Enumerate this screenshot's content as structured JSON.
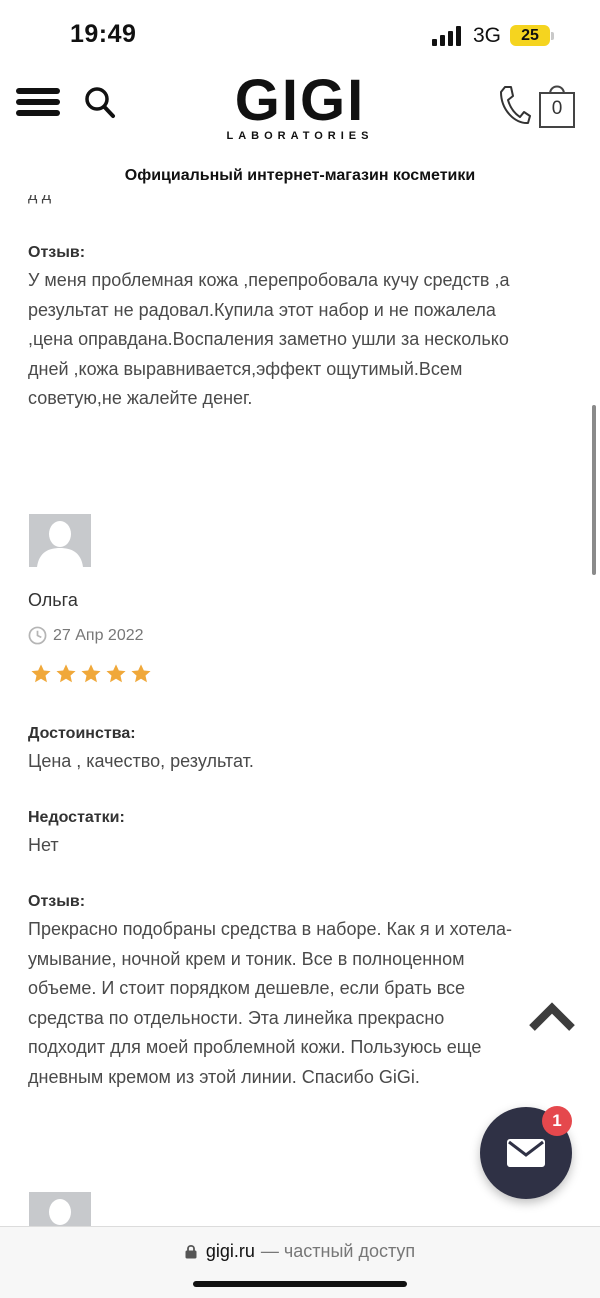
{
  "status_bar": {
    "time": "19:49",
    "network": "3G",
    "battery": "25"
  },
  "header": {
    "logo_main": "GIGI",
    "logo_sub": "LABORATORIES",
    "cart_count": "0",
    "tagline": "Официальный интернет-магазин косметики"
  },
  "review_prev": {
    "label": "Отзыв:",
    "text": "У меня проблемная кожа ,перепробовала кучу средств ,а\nрезультат не радовал.Купила этот набор и не пожалела\n,цена оправдана.Воспаления заметно ушли за несколько\nдней ,кожа выравнивается,эффект ощутимый.Всем\nсоветую,не жалейте денег."
  },
  "review": {
    "author": "Ольга",
    "date": "27 Апр 2022",
    "rating": 5,
    "pros_label": "Достоинства:",
    "pros_text": "Цена , качество, результат.",
    "cons_label": "Недостатки:",
    "cons_text": "Нет",
    "review_label": "Отзыв:",
    "review_text": "Прекрасно подобраны средства в наборе. Как я и хотела-\nумывание, ночной крем и тоник. Все в полноценном\nобъеме. И стоит порядком дешевле, если брать все\n средства по отдельности. Эта линейка прекрасно\nподходит для моей проблемной кожи. Пользуюсь еще\nдневным кремом из этой линии. Спасибо GiGi."
  },
  "chat": {
    "badge_count": "1"
  },
  "url_bar": {
    "domain": "gigi.ru",
    "suffix": "— частный доступ"
  },
  "colors": {
    "star": "#f0a83a",
    "chat_button": "#2f3145",
    "badge": "#e5484d",
    "battery": "#f5d41f"
  },
  "icons": [
    "menu-icon",
    "search-icon",
    "phone-icon",
    "cart-icon",
    "clock-icon",
    "star-icon",
    "scroll-up-icon",
    "mail-icon",
    "lock-icon"
  ]
}
